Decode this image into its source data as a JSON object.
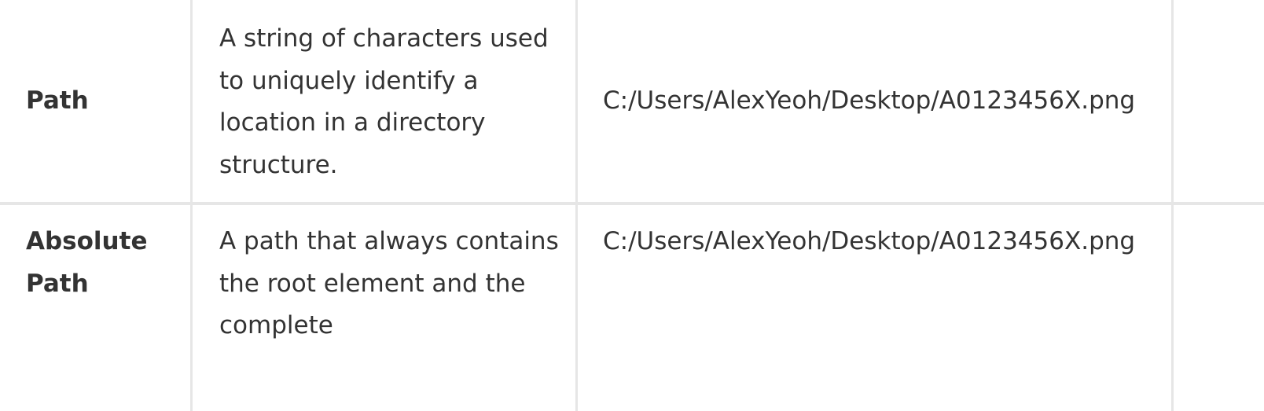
{
  "table": {
    "rows": [
      {
        "term": "Path",
        "description": "A string of characters used to uniquely identify a location in a directory structure.",
        "example": "C:/Users/AlexYeoh/Desktop/A0123456X.png"
      },
      {
        "term": "Absolute Path",
        "description": "A path that always contains the root element and the complete",
        "example": "C:/Users/AlexYeoh/Desktop/A0123456X.png"
      }
    ]
  }
}
